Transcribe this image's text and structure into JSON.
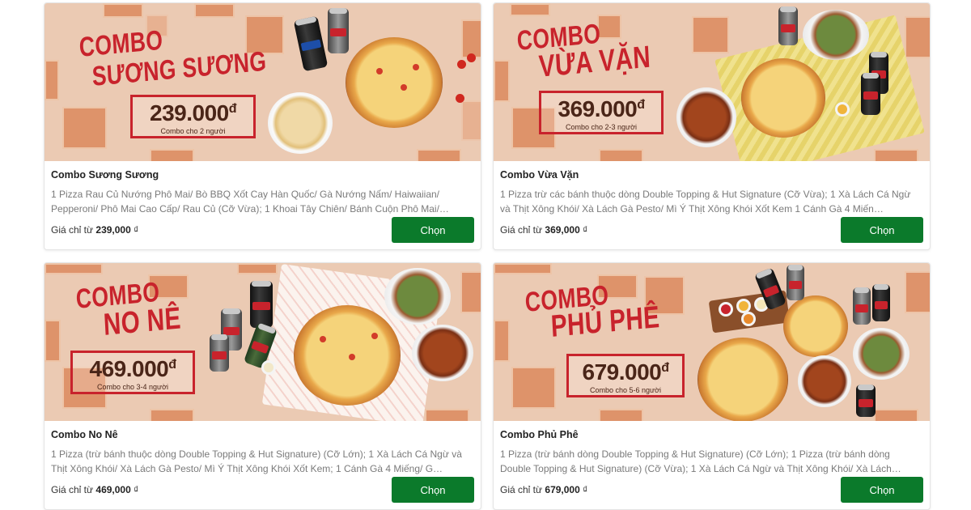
{
  "combos": [
    {
      "banner": {
        "word1": "COMBO",
        "word2": "SƯƠNG SƯƠNG",
        "price": "239.000",
        "currency_symbol": "đ",
        "people": "Combo cho 2 người"
      },
      "name": "Combo Sương Sương",
      "description": "1 Pizza Rau Củ Nướng Phô Mai/ Bò BBQ Xốt Cay Hàn Quốc/ Gà Nướng Nấm/ Haiwaiian/ Pepperoni/ Phô Mai Cao Cấp/ Rau Củ (Cỡ Vừa); 1 Khoai Tây Chiên/ Bánh Cuộn Phô Mai/…",
      "price_prefix": "Giá chỉ từ",
      "price_value": "239,000",
      "price_unit": "₫",
      "button_label": "Chọn"
    },
    {
      "banner": {
        "word1": "COMBO",
        "word2": "VỪA VẶN",
        "price": "369.000",
        "currency_symbol": "đ",
        "people": "Combo cho 2-3 người"
      },
      "name": "Combo Vừa Vặn",
      "description": "1 Pizza trừ các bánh thuộc dòng Double Topping & Hut Signature (Cỡ Vừa); 1 Xà Lách Cá Ngừ và Thịt Xông Khói/ Xà Lách Gà Pesto/ Mì Ý Thịt Xông Khói Xốt Kem 1 Cánh Gà 4 Miến…",
      "price_prefix": "Giá chỉ từ",
      "price_value": "369,000",
      "price_unit": "₫",
      "button_label": "Chọn"
    },
    {
      "banner": {
        "word1": "COMBO",
        "word2": "NO NÊ",
        "price": "469.000",
        "currency_symbol": "đ",
        "people": "Combo cho 3-4 người"
      },
      "name": "Combo No Nê",
      "description": "1 Pizza (trừ bánh thuộc dòng Double Topping & Hut Signature) (Cỡ Lớn); 1 Xà Lách Cá Ngừ và Thịt Xông Khói/ Xà Lách Gà Pesto/ Mì Ý Thịt Xông Khói Xốt Kem; 1 Cánh Gà 4 Miếng/ G…",
      "price_prefix": "Giá chỉ từ",
      "price_value": "469,000",
      "price_unit": "₫",
      "button_label": "Chọn"
    },
    {
      "banner": {
        "word1": "COMBO",
        "word2": "PHỦ PHÊ",
        "price": "679.000",
        "currency_symbol": "đ",
        "people": "Combo cho 5-6 người"
      },
      "name": "Combo Phủ Phê",
      "description": "1 Pizza (trừ bánh dòng Double Topping & Hut Signature) (Cỡ Lớn); 1 Pizza (trừ bánh dòng Double Topping & Hut Signature) (Cỡ Vừa); 1 Xà Lách Cá Ngừ và Thịt Xông Khói/ Xà Lách…",
      "price_prefix": "Giá chỉ từ",
      "price_value": "679,000",
      "price_unit": "₫",
      "button_label": "Chọn"
    }
  ],
  "colors": {
    "brand_red": "#c8232c",
    "button_green": "#0b7a2b",
    "banner_bg": "#ebcab3"
  }
}
